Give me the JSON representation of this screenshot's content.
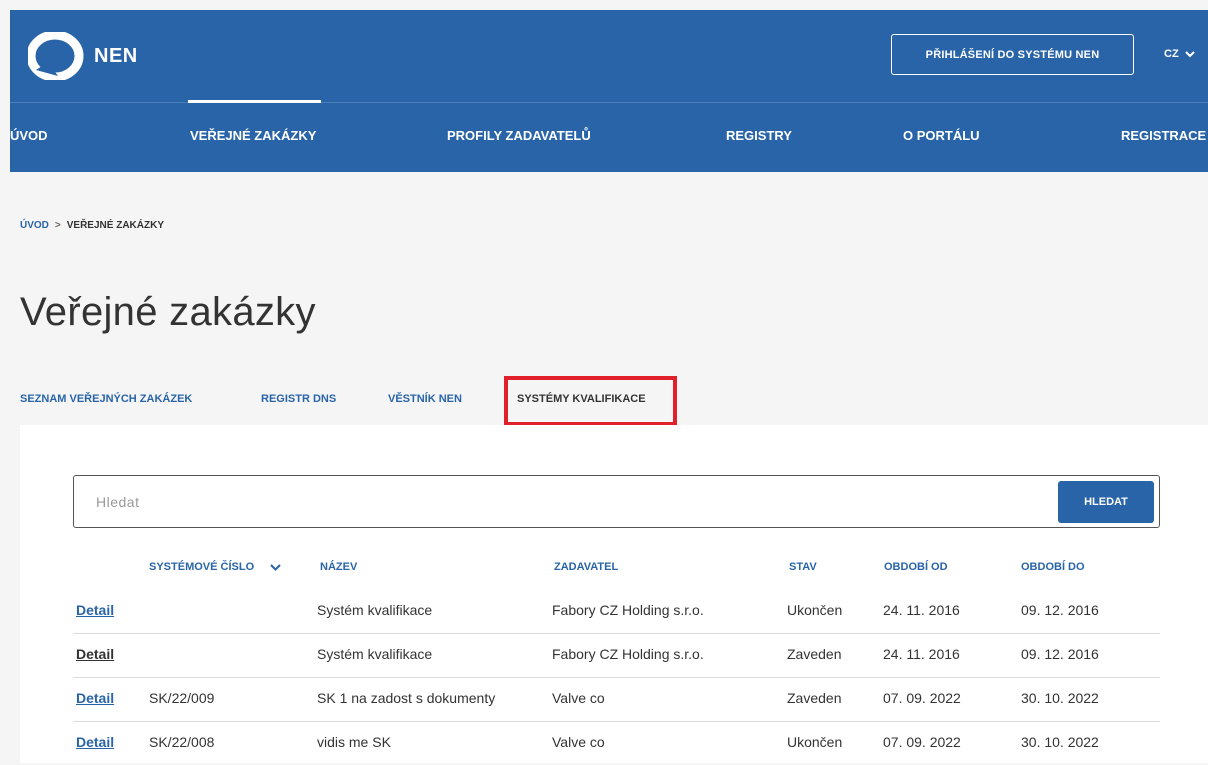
{
  "header": {
    "logo_text": "NEN",
    "login_label": "PŘIHLÁŠENÍ DO SYSTÉMU NEN",
    "language": "CZ",
    "brand_color": "#2a64a8"
  },
  "nav": {
    "items": [
      {
        "label": "ÚVOD"
      },
      {
        "label": "VEŘEJNÉ ZAKÁZKY"
      },
      {
        "label": "PROFILY ZADAVATELŮ"
      },
      {
        "label": "REGISTRY"
      },
      {
        "label": "O PORTÁLU"
      },
      {
        "label": "REGISTRACE"
      }
    ],
    "active": "VEŘEJNÉ ZAKÁZKY"
  },
  "breadcrumb": {
    "home": "ÚVOD",
    "separator": ">",
    "current": "VEŘEJNÉ ZAKÁZKY"
  },
  "page": {
    "title": "Veřejné zakázky"
  },
  "tabs": [
    {
      "label": "SEZNAM VEŘEJNÝCH ZAKÁZEK"
    },
    {
      "label": "REGISTR DNS"
    },
    {
      "label": "VĚSTNÍK NEN"
    },
    {
      "label": "SYSTÉMY KVALIFIKACE"
    }
  ],
  "active_tab": "SYSTÉMY KVALIFIKACE",
  "search": {
    "placeholder": "Hledat",
    "value": "",
    "button_label": "HLEDAT"
  },
  "table": {
    "columns": {
      "system_number": "SYSTÉMOVÉ ČÍSLO",
      "name": "NÁZEV",
      "contracting_authority": "ZADAVATEL",
      "status": "STAV",
      "period_from": "OBDOBÍ OD",
      "period_to": "OBDOBÍ DO"
    },
    "rows": [
      {
        "detail": "Detail",
        "number": "",
        "name": "Systém kvalifikace",
        "authority": "Fabory CZ Holding s.r.o.",
        "status": "Ukončen",
        "from": "24. 11. 2016",
        "to": "09. 12. 2016"
      },
      {
        "detail": "Detail",
        "number": "",
        "name": "Systém kvalifikace",
        "authority": "Fabory CZ Holding s.r.o.",
        "status": "Zaveden",
        "from": "24. 11. 2016",
        "to": "09. 12. 2016"
      },
      {
        "detail": "Detail",
        "number": "SK/22/009",
        "name": "SK 1 na zadost s dokumenty",
        "authority": "Valve co",
        "status": "Zaveden",
        "from": "07. 09. 2022",
        "to": "30. 10. 2022"
      },
      {
        "detail": "Detail",
        "number": "SK/22/008",
        "name": "vidis me SK",
        "authority": "Valve co",
        "status": "Ukončen",
        "from": "07. 09. 2022",
        "to": "30. 10. 2022"
      }
    ]
  }
}
